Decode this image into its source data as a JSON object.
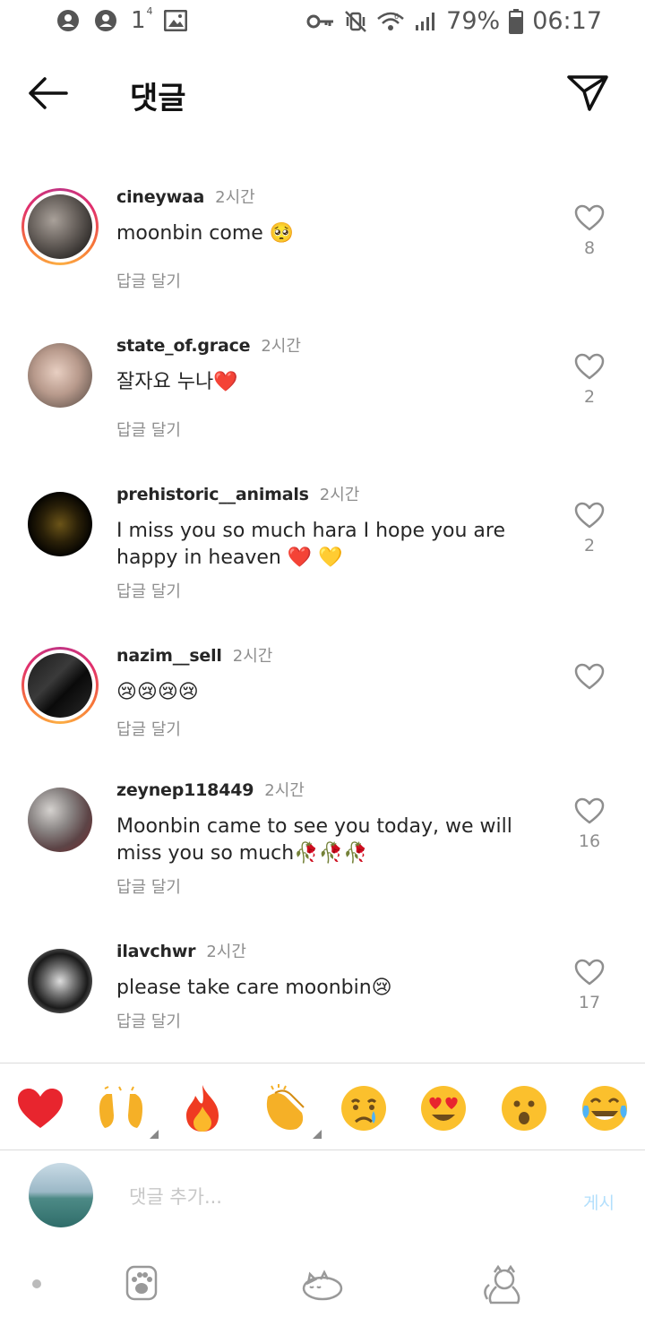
{
  "status_bar": {
    "notification_count": "1",
    "notification_sup": "4",
    "battery": "79%",
    "time": "06:17",
    "icons": [
      "account-circle-icon",
      "account-circle-icon",
      "notification-count-icon",
      "gallery-icon",
      "vpn-key-icon",
      "vibrate-mute-icon",
      "wifi-icon",
      "signal-icon",
      "battery-icon"
    ]
  },
  "header": {
    "title": "댓글",
    "back_icon": "back-arrow-icon",
    "send_icon": "paper-plane-icon"
  },
  "comments": [
    {
      "username": "cineywaa",
      "time": "2시간",
      "text": "moonbin come 🥺",
      "reply_label": "답글 달기",
      "likes": "8",
      "story_ring": true
    },
    {
      "username": "state_of.grace",
      "time": "2시간",
      "text": "잘자요 누나❤️",
      "reply_label": "답글 달기",
      "likes": "2",
      "story_ring": false
    },
    {
      "username": "prehistoric__animals",
      "time": "2시간",
      "text": "I miss you so much hara I hope you are happy in heaven ❤️ 💛",
      "reply_label": "답글 달기",
      "likes": "2",
      "story_ring": false
    },
    {
      "username": "nazim__sell",
      "time": "2시간",
      "text": "😢😢😢😢",
      "reply_label": "답글 달기",
      "likes": "",
      "story_ring": true
    },
    {
      "username": "zeynep118449",
      "time": "2시간",
      "text": "Moonbin came to see you today, we will miss you so much🥀🥀🥀",
      "reply_label": "답글 달기",
      "likes": "16",
      "story_ring": false
    },
    {
      "username": "ilavchwr",
      "time": "2시간",
      "text": "please take care moonbin😢",
      "reply_label": "답글 달기",
      "likes": "17",
      "story_ring": false
    }
  ],
  "emoji_bar": [
    "❤️",
    "🙌",
    "🔥",
    "👏",
    "😢",
    "😍",
    "😮",
    "😂"
  ],
  "input": {
    "placeholder": "댓글 추가...",
    "post_label": "게시"
  },
  "bottom_bar": {
    "icons": [
      "paw-icon",
      "sleeping-cat-icon",
      "cat-icon"
    ]
  },
  "colors": {
    "text_primary": "#262626",
    "text_secondary": "#8e8e8e",
    "post_button": "#b2dffc",
    "like_outline": "#8e8e8e"
  }
}
